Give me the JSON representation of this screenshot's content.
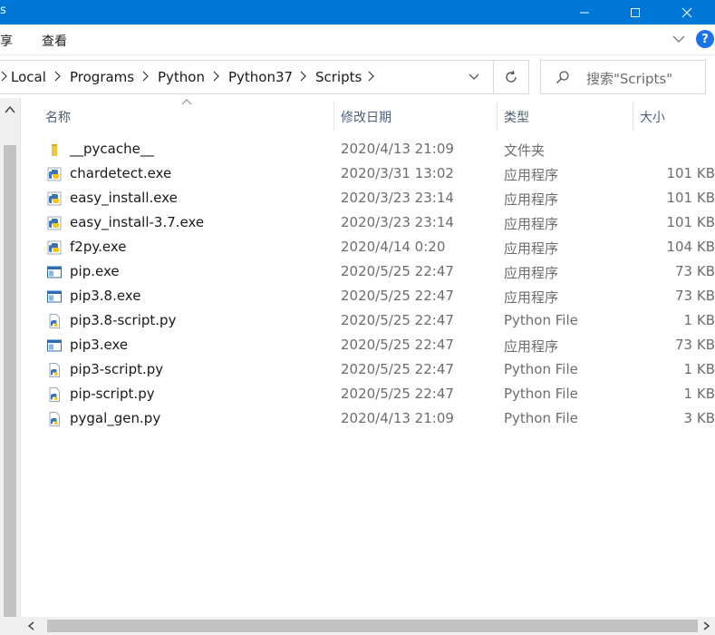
{
  "window": {
    "title_partial": "s",
    "colors": {
      "titlebar": "#0078d7",
      "accent": "#1a73e8"
    }
  },
  "ribbon": {
    "tabs": [
      {
        "label": "享"
      },
      {
        "label": "查看"
      }
    ],
    "help_label": "?"
  },
  "address": {
    "breadcrumbs": [
      "Local",
      "Programs",
      "Python",
      "Python37",
      "Scripts"
    ]
  },
  "search": {
    "placeholder": "搜索\"Scripts\""
  },
  "columns": {
    "name": "名称",
    "date": "修改日期",
    "type": "类型",
    "size": "大小"
  },
  "files": [
    {
      "name": "__pycache__",
      "date": "2020/4/13 21:09",
      "type": "文件夹",
      "size": "",
      "icon": "folder-icon"
    },
    {
      "name": "chardetect.exe",
      "date": "2020/3/31 13:02",
      "type": "应用程序",
      "size": "101 KB",
      "icon": "python-exe-icon"
    },
    {
      "name": "easy_install.exe",
      "date": "2020/3/23 23:14",
      "type": "应用程序",
      "size": "101 KB",
      "icon": "python-exe-icon"
    },
    {
      "name": "easy_install-3.7.exe",
      "date": "2020/3/23 23:14",
      "type": "应用程序",
      "size": "101 KB",
      "icon": "python-exe-icon"
    },
    {
      "name": "f2py.exe",
      "date": "2020/4/14 0:20",
      "type": "应用程序",
      "size": "104 KB",
      "icon": "python-exe-icon"
    },
    {
      "name": "pip.exe",
      "date": "2020/5/25 22:47",
      "type": "应用程序",
      "size": "73 KB",
      "icon": "exe-window-icon"
    },
    {
      "name": "pip3.8.exe",
      "date": "2020/5/25 22:47",
      "type": "应用程序",
      "size": "73 KB",
      "icon": "exe-window-icon"
    },
    {
      "name": "pip3.8-script.py",
      "date": "2020/5/25 22:47",
      "type": "Python File",
      "size": "1 KB",
      "icon": "python-file-icon"
    },
    {
      "name": "pip3.exe",
      "date": "2020/5/25 22:47",
      "type": "应用程序",
      "size": "73 KB",
      "icon": "exe-window-icon"
    },
    {
      "name": "pip3-script.py",
      "date": "2020/5/25 22:47",
      "type": "Python File",
      "size": "1 KB",
      "icon": "python-file-icon"
    },
    {
      "name": "pip-script.py",
      "date": "2020/5/25 22:47",
      "type": "Python File",
      "size": "1 KB",
      "icon": "python-file-icon"
    },
    {
      "name": "pygal_gen.py",
      "date": "2020/4/13 21:09",
      "type": "Python File",
      "size": "3 KB",
      "icon": "python-file-icon"
    }
  ]
}
